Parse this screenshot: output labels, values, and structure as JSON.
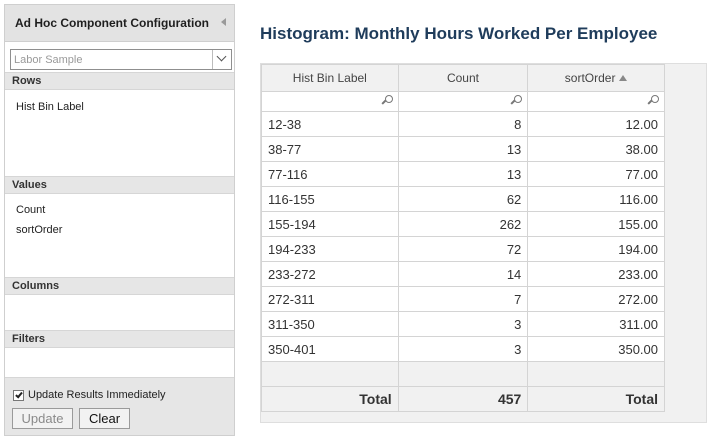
{
  "panel": {
    "title": "Ad Hoc Component Configuration",
    "source_select": {
      "value": "Labor Sample"
    },
    "sections": {
      "rows": {
        "label": "Rows",
        "items": [
          "Hist Bin Label"
        ]
      },
      "values": {
        "label": "Values",
        "items": [
          "Count",
          "sortOrder"
        ]
      },
      "columns": {
        "label": "Columns",
        "items": []
      },
      "filters": {
        "label": "Filters",
        "items": []
      }
    },
    "update_immediately": {
      "label": "Update Results Immediately",
      "checked": true
    },
    "update_button": "Update",
    "clear_button": "Clear"
  },
  "report": {
    "title": "Histogram: Monthly Hours Worked Per Employee",
    "columns": [
      "Hist Bin Label",
      "Count",
      "sortOrder"
    ],
    "sorted_column": "sortOrder",
    "sort_direction": "ascending",
    "rows": [
      [
        "12-38",
        "8",
        "12.00"
      ],
      [
        "38-77",
        "13",
        "38.00"
      ],
      [
        "77-116",
        "13",
        "77.00"
      ],
      [
        "116-155",
        "62",
        "116.00"
      ],
      [
        "155-194",
        "262",
        "155.00"
      ],
      [
        "194-233",
        "72",
        "194.00"
      ],
      [
        "233-272",
        "14",
        "233.00"
      ],
      [
        "272-311",
        "7",
        "272.00"
      ],
      [
        "311-350",
        "3",
        "311.00"
      ],
      [
        "350-401",
        "3",
        "350.00"
      ]
    ],
    "totals": [
      "Total",
      "457",
      "Total"
    ]
  }
}
